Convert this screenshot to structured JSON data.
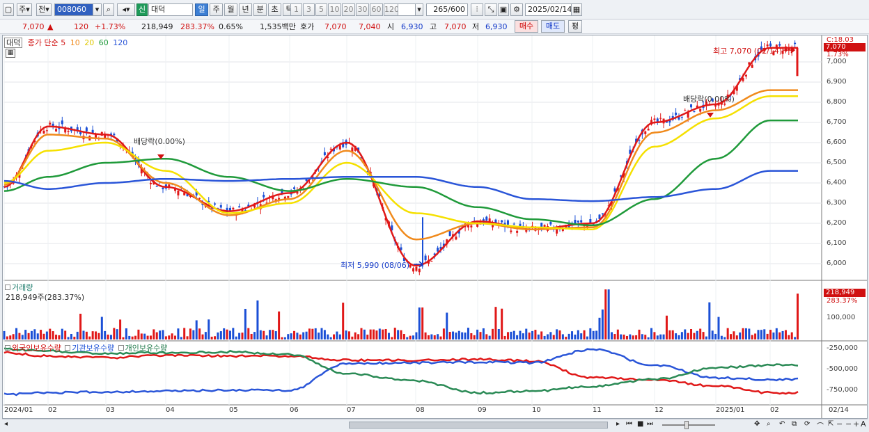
{
  "toolbar": {
    "market_label": "주",
    "prev_label": "전",
    "code_value": "008060",
    "new_badge": "신",
    "stock_name": "대덕",
    "periods": [
      "일",
      "주",
      "월",
      "년",
      "분",
      "초",
      "틱"
    ],
    "intervals": [
      "1",
      "3",
      "5",
      "10",
      "20",
      "30",
      "60",
      "120"
    ],
    "count_value": "265",
    "count_total": "/600",
    "date_value": "2025/02/14"
  },
  "quote": {
    "price": "7,070",
    "up_mark": "▲",
    "change": "120",
    "change_pct": "+1.73%",
    "volume": "218,949",
    "volume_ratio": "283.37%",
    "turnover_pct": "0.65%",
    "amount": "1,535백만",
    "hoga_label": "호가",
    "ask": "7,070",
    "bid": "7,040",
    "open_label": "시",
    "open": "6,930",
    "high_label": "고",
    "high": "7,070",
    "low_label": "저",
    "low": "6,930",
    "buy_label": "매수",
    "sell_label": "매도",
    "eval_label": "평"
  },
  "legend": {
    "name": "대덕",
    "ma_title": "종가 단순",
    "ma5": "5",
    "ma10": "10",
    "ma20": "20",
    "ma60": "60",
    "ma120": "120"
  },
  "price_axis": {
    "ticks": [
      "7,000",
      "6,900",
      "6,800",
      "6,700",
      "6,600",
      "6,500",
      "6,400",
      "6,300",
      "6,200",
      "6,100",
      "6,000"
    ],
    "top_label": "C:18.03",
    "current": "7,070",
    "current_pct": "1.73%"
  },
  "annotations": {
    "high": "최고 7,070 (02/14)",
    "low": "최저 5,990 (08/06)",
    "div1": "배당락(0.00%)",
    "div2": "배당락(0.00%)"
  },
  "volume_panel": {
    "title": "거래량",
    "value": "218,949주(283.37%)",
    "axis_tick": "100,000",
    "current": "218,949",
    "current_pct": "283.37%"
  },
  "holdings_panel": {
    "foreign": "외국인보유수량",
    "inst": "기관보유수량",
    "retail": "개인보유수량",
    "ticks": [
      "-250,000",
      "-500,000",
      "-750,000"
    ]
  },
  "x_axis": [
    "2024/01",
    "02",
    "03",
    "04",
    "05",
    "06",
    "07",
    "08",
    "09",
    "10",
    "11",
    "12",
    "2025/01",
    "02"
  ],
  "x_axis_last": "02/14",
  "colors": {
    "up": "#e01818",
    "down": "#1a4fd6",
    "ma5": "#e01818",
    "ma10": "#f08a1c",
    "ma20": "#f5e000",
    "ma60": "#1f9a3a",
    "ma120": "#2a55d8"
  },
  "chart_data": [
    {
      "type": "line",
      "title": "",
      "x": [
        "2024/01",
        "02",
        "03",
        "04",
        "05",
        "06",
        "07",
        "08",
        "09",
        "10",
        "11",
        "12",
        "2025/01",
        "02"
      ],
      "series": [
        {
          "name": "5",
          "values": [
            6380,
            6680,
            6640,
            6380,
            6260,
            6350,
            6600,
            5990,
            6210,
            6170,
            6200,
            6700,
            6790,
            7070
          ]
        },
        {
          "name": "10",
          "values": [
            6390,
            6640,
            6620,
            6400,
            6240,
            6320,
            6560,
            6120,
            6200,
            6170,
            6180,
            6650,
            6760,
            6860
          ]
        },
        {
          "name": "20",
          "values": [
            6400,
            6560,
            6600,
            6460,
            6250,
            6300,
            6500,
            6250,
            6200,
            6180,
            6170,
            6580,
            6720,
            6830
          ]
        },
        {
          "name": "60",
          "values": [
            6360,
            6430,
            6500,
            6520,
            6430,
            6360,
            6420,
            6380,
            6280,
            6220,
            6190,
            6320,
            6520,
            6710
          ]
        },
        {
          "name": "120",
          "values": [
            6410,
            6370,
            6400,
            6420,
            6410,
            6420,
            6430,
            6430,
            6380,
            6320,
            6310,
            6330,
            6370,
            6460
          ]
        }
      ],
      "ylim": [
        5950,
        7120
      ]
    }
  ]
}
